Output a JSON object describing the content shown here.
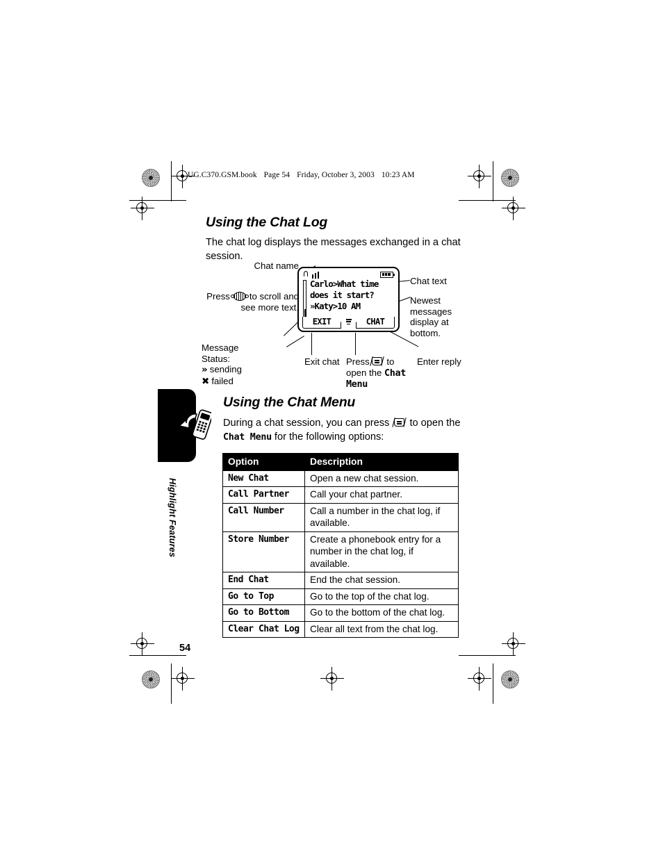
{
  "file_header": {
    "book": "UG.C370.GSM.book",
    "page": "Page 54",
    "day": "Friday, October 3, 2003",
    "time": "10:23 AM"
  },
  "sections": {
    "chat_log": {
      "heading": "Using the Chat Log",
      "intro": "The chat log displays the messages exchanged in a chat session."
    },
    "chat_menu": {
      "heading": "Using the Chat Menu",
      "paragraph_before_icon": "During a chat session, you can press",
      "paragraph_after_icon": "to open the",
      "menu_name": "Chat Menu",
      "paragraph_tail": "for the following options:"
    }
  },
  "diagram": {
    "screen": {
      "chat_lines": [
        "Carlo>What time",
        "does it start?",
        "»Katy>10 AM"
      ],
      "softkey_left": "EXIT",
      "softkey_right": "CHAT"
    },
    "callouts": {
      "chat_name": "Chat name",
      "press_scroll_before": "Press",
      "press_scroll_after": "to scroll and see more text.",
      "message_status_title": "Message Status:",
      "status_sending_symbol": "»",
      "status_sending_label": "sending",
      "status_failed_symbol": "✖",
      "status_failed_label": "failed",
      "exit_chat": "Exit chat",
      "press_menu_before": "Press",
      "press_menu_after": "to open the",
      "press_menu_bold": "Chat Menu",
      "enter_reply": "Enter reply",
      "chat_text": "Chat text",
      "newest_messages": "Newest messages display at bottom."
    }
  },
  "side_tab": {
    "label": "Highlight Features"
  },
  "options_table": {
    "headers": [
      "Option",
      "Description"
    ],
    "rows": [
      {
        "option": "New Chat",
        "description": "Open a new chat session."
      },
      {
        "option": "Call Partner",
        "description": "Call your chat partner."
      },
      {
        "option": "Call Number",
        "description": "Call a number in the chat log, if available."
      },
      {
        "option": "Store Number",
        "description": "Create a phonebook entry for a number in the chat log, if available."
      },
      {
        "option": "End Chat",
        "description": "End the chat session."
      },
      {
        "option": "Go to Top",
        "description": "Go to the top of the chat log."
      },
      {
        "option": "Go to Bottom",
        "description": "Go to the bottom of the chat log."
      },
      {
        "option": "Clear Chat Log",
        "description": "Clear all text from the chat log."
      }
    ]
  },
  "page_number": "54"
}
